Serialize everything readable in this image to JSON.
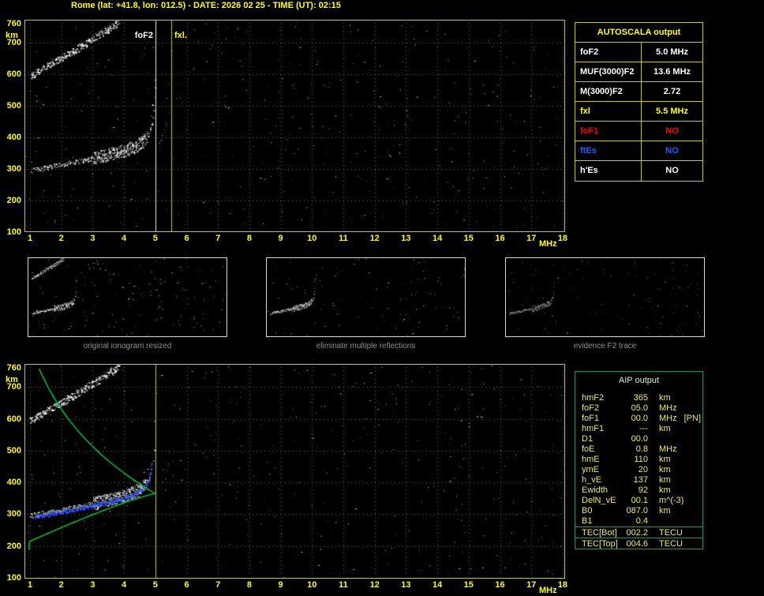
{
  "header": {
    "title": "Rome (lat: +41.8, lon: 012.5) - DATE: 2026 02 25 - TIME (UT): 02:15"
  },
  "axes": {
    "y_unit": "km",
    "x_unit": "MHz",
    "y_ticks": [
      "760",
      "700",
      "600",
      "500",
      "400",
      "300",
      "200",
      "100"
    ],
    "x_ticks": [
      "1",
      "2",
      "3",
      "4",
      "5",
      "6",
      "7",
      "8",
      "9",
      "10",
      "11",
      "12",
      "13",
      "14",
      "15",
      "16",
      "17",
      "18"
    ]
  },
  "ionogram": {
    "foF2_label": "foF2",
    "fxl_label": "fxl.",
    "foF2_mhz": 5.0,
    "fxl_mhz": 5.5,
    "x_range_mhz": [
      1,
      18
    ],
    "y_range_km": [
      100,
      760
    ]
  },
  "autoscala": {
    "title": "AUTOSCALA output",
    "rows": [
      {
        "param": "foF2",
        "value": "5.0 MHz",
        "color": "#ffffff"
      },
      {
        "param": "MUF(3000)F2",
        "value": "13.6 MHz",
        "color": "#ffffff"
      },
      {
        "param": "M(3000)F2",
        "value": "2.72",
        "color": "#ffffff"
      },
      {
        "param": "fxl",
        "value": "5.5 MHz",
        "color": "#ffff00"
      },
      {
        "param": "foF1",
        "value": "NO",
        "color": "#ff0000"
      },
      {
        "param": "ftEs",
        "value": "NO",
        "color": "#1a5cff"
      },
      {
        "param": "h'Es",
        "value": "NO",
        "color": "#ffffff"
      }
    ]
  },
  "thumbnails": [
    {
      "caption": "original ionogram resized"
    },
    {
      "caption": "eliminate multiple reflections"
    },
    {
      "caption": "evidence F2 trace"
    }
  ],
  "aip": {
    "title": "AIP output",
    "rows": [
      {
        "param": "hmF2",
        "value": "365",
        "unit": "km",
        "extra": ""
      },
      {
        "param": "foF2",
        "value": "05.0",
        "unit": "MHz",
        "extra": ""
      },
      {
        "param": "foF1",
        "value": "00.0",
        "unit": "MHz",
        "extra": "[PN]"
      },
      {
        "param": "hmF1",
        "value": "---",
        "unit": "km",
        "extra": ""
      },
      {
        "param": "D1",
        "value": "00.0",
        "unit": "",
        "extra": ""
      },
      {
        "param": "foE",
        "value": "0.8",
        "unit": "MHz",
        "extra": ""
      },
      {
        "param": "hmE",
        "value": "110",
        "unit": "km",
        "extra": ""
      },
      {
        "param": "ymE",
        "value": "20",
        "unit": "km",
        "extra": ""
      },
      {
        "param": "h_vE",
        "value": "137",
        "unit": "km",
        "extra": ""
      },
      {
        "param": "Ewidth",
        "value": "92",
        "unit": "km",
        "extra": ""
      },
      {
        "param": "DelN_vE",
        "value": "00.1",
        "unit": "m^(-3)",
        "extra": ""
      },
      {
        "param": "B0",
        "value": "087.0",
        "unit": "km",
        "extra": ""
      },
      {
        "param": "B1",
        "value": "0.4",
        "unit": "",
        "extra": ""
      }
    ],
    "tec_rows": [
      {
        "param": "TEC[Bot]",
        "value": "002.2",
        "unit": "TECU",
        "extra": ""
      },
      {
        "param": "TEC[Top]",
        "value": "004.6",
        "unit": "TECU",
        "extra": ""
      }
    ]
  },
  "colors": {
    "accent_yellow": "#ffff00",
    "plot_border": "#caca00",
    "aip_border": "#00a845",
    "aip_text": "#ecec5e",
    "caption_gray": "#8f8f8f",
    "status_red": "#ff0000",
    "status_blue": "#1a5cff",
    "profile_green": "#00cf4a",
    "trace_blue": "#3255ff",
    "line_white": "#eeeeee",
    "line_yellow": "#cccc00"
  }
}
